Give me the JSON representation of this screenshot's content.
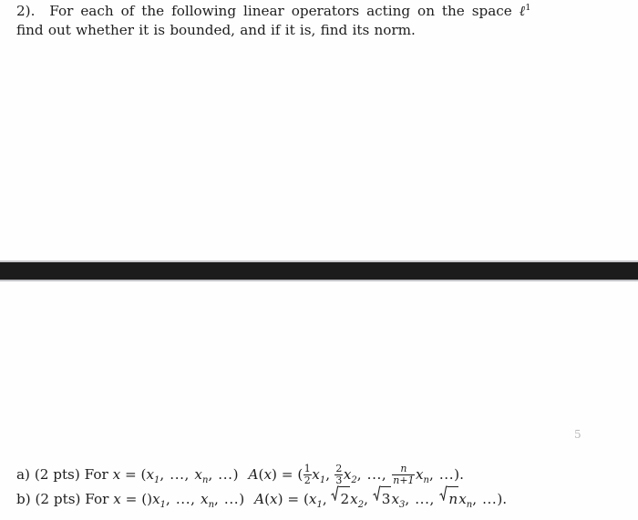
{
  "document": {
    "type": "scanned-math-worksheet",
    "page_number": "5",
    "background_color": "#fefefe",
    "text_color": "#1d1d1d",
    "separator_bar_color": "#1c1c1c"
  },
  "statement": {
    "line1_prefix": "2).",
    "line1_text": "For each of the following linear operators acting on the space",
    "line1_symbol": "ℓ",
    "line1_symbol_sup": "1",
    "line2_text": "find out whether it is bounded, and if it is, find its norm."
  },
  "items": {
    "a": {
      "label": "a)",
      "points": "(2 pts)",
      "for_word": "For",
      "var": "x",
      "equals": "=",
      "domain_open": "(",
      "domain_x1": "x",
      "domain_x1_sub": "1",
      "domain_dots1": ", ..., ",
      "domain_xn": "x",
      "domain_xn_sub": "n",
      "domain_dots2": ", ...",
      "domain_close": ")",
      "op_name": "A",
      "op_arg_open": "(",
      "op_arg": "x",
      "op_arg_close": ")",
      "op_equals": "=",
      "range_open": "(",
      "frac1_num": "1",
      "frac1_den": "2",
      "term1_var": "x",
      "term1_sub": "1",
      "sep1": ", ",
      "frac2_num": "2",
      "frac2_den": "3",
      "term2_var": "x",
      "term2_sub": "2",
      "sep2": ", ..., ",
      "frac3_num": "n",
      "frac3_den": "n+1",
      "term3_var": "x",
      "term3_sub": "n",
      "sep3": ", ...",
      "range_close": ")",
      "period": "."
    },
    "b": {
      "label": "b)",
      "points": "(2 pts)",
      "for_word": "For",
      "var": "x",
      "equals": "=",
      "stray_parens": "()",
      "domain_x1": "x",
      "domain_x1_sub": "1",
      "domain_dots1": ", ..., ",
      "domain_xn": "x",
      "domain_xn_sub": "n",
      "domain_dots2": ", ...",
      "domain_close": ")",
      "op_name": "A",
      "op_arg_open": "(",
      "op_arg": "x",
      "op_arg_close": ")",
      "op_equals": "=",
      "range_open": "(",
      "term1_var": "x",
      "term1_sub": "1",
      "sep1": ", ",
      "rad2": "2",
      "term2_var": "x",
      "term2_sub": "2",
      "sep2": ", ",
      "rad3": "3",
      "term3_var": "x",
      "term3_sub": "3",
      "sep3": ", ..., ",
      "radn": "n",
      "termn_var": "x",
      "termn_sub": "n",
      "sep4": ", ...",
      "range_close": ")",
      "period": "."
    }
  }
}
